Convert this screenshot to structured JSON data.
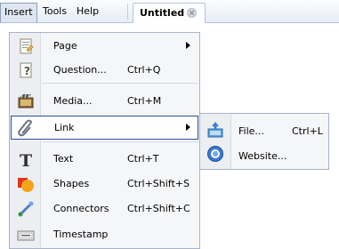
{
  "menubar": {
    "items": [
      "Insert",
      "Tools",
      "Help"
    ],
    "document_tab": "Untitled *"
  },
  "insert_menu": {
    "items": [
      {
        "label": "Page",
        "shortcut": "",
        "submenu": true,
        "icon": "page-icon"
      },
      {
        "label": "Question...",
        "shortcut": "Ctrl+Q",
        "submenu": false,
        "icon": "question-page-icon"
      },
      {
        "label": "Media...",
        "shortcut": "Ctrl+M",
        "submenu": false,
        "icon": "film-icon"
      },
      {
        "label": "Link",
        "shortcut": "",
        "submenu": true,
        "icon": "paperclip-icon",
        "highlighted": true
      },
      {
        "label": "Text",
        "shortcut": "Ctrl+T",
        "submenu": false,
        "icon": "text-t-icon"
      },
      {
        "label": "Shapes",
        "shortcut": "Ctrl+Shift+S",
        "submenu": false,
        "icon": "shapes-icon"
      },
      {
        "label": "Connectors",
        "shortcut": "Ctrl+Shift+C",
        "submenu": false,
        "icon": "connector-icon"
      },
      {
        "label": "Timestamp",
        "shortcut": "",
        "submenu": false,
        "icon": "timestamp-icon"
      }
    ]
  },
  "link_submenu": {
    "items": [
      {
        "label": "File...",
        "shortcut": "Ctrl+L",
        "icon": "file-upload-icon"
      },
      {
        "label": "Website...",
        "shortcut": "",
        "icon": "globe-icon"
      }
    ]
  },
  "colors": {
    "highlight_border": "#2b4f98",
    "menu_background": "#f5f6f8",
    "menubar_background": "#e7edf6"
  }
}
